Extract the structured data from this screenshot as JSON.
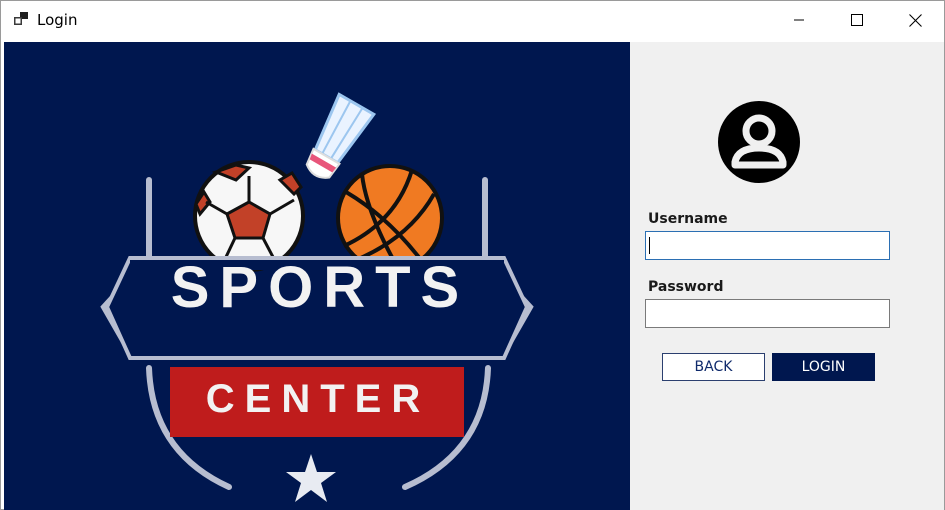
{
  "window": {
    "title": "Login",
    "app_icon": "app-window-icon",
    "controls": [
      "minimize-icon",
      "maximize-icon",
      "close-icon"
    ]
  },
  "hero": {
    "logo_word_top": "SPORTS",
    "logo_word_bottom": "CENTER",
    "background_color": "#00174f",
    "accent_red": "#bf1c1c",
    "icons": [
      "soccer-ball-icon",
      "shuttlecock-icon",
      "basketball-icon",
      "star-icon"
    ]
  },
  "form": {
    "avatar_icon": "user-avatar-icon",
    "username_label": "Username",
    "username_value": "",
    "password_label": "Password",
    "password_value": "",
    "back_label": "BACK",
    "login_label": "LOGIN",
    "accent": "#00174f"
  }
}
